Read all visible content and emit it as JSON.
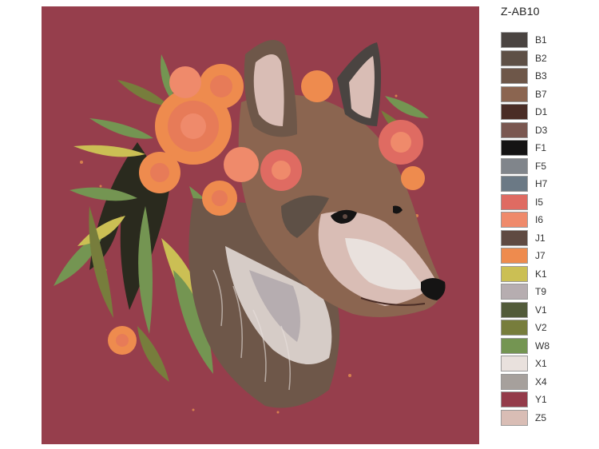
{
  "product_code": "Z-AB10",
  "artwork": {
    "background_color": "#963e4c"
  },
  "palette": [
    {
      "code": "B1",
      "color": "#4a4441"
    },
    {
      "code": "B2",
      "color": "#5e5046"
    },
    {
      "code": "B3",
      "color": "#6e5749"
    },
    {
      "code": "B7",
      "color": "#8b6550"
    },
    {
      "code": "D1",
      "color": "#4a2d26"
    },
    {
      "code": "D3",
      "color": "#7a5750"
    },
    {
      "code": "F1",
      "color": "#151414"
    },
    {
      "code": "F5",
      "color": "#80858b"
    },
    {
      "code": "H7",
      "color": "#6b7985"
    },
    {
      "code": "I5",
      "color": "#df6b62"
    },
    {
      "code": "I6",
      "color": "#ef8a6b"
    },
    {
      "code": "J1",
      "color": "#5f4a42"
    },
    {
      "code": "J7",
      "color": "#ee8b4e"
    },
    {
      "code": "K1",
      "color": "#cbbf54"
    },
    {
      "code": "T9",
      "color": "#b6adb0"
    },
    {
      "code": "V1",
      "color": "#525b3a"
    },
    {
      "code": "V2",
      "color": "#777d3c"
    },
    {
      "code": "W8",
      "color": "#749552"
    },
    {
      "code": "X1",
      "color": "#e9e1dd"
    },
    {
      "code": "X4",
      "color": "#a6a09c"
    },
    {
      "code": "Y1",
      "color": "#943b4a"
    },
    {
      "code": "Z5",
      "color": "#d9bdb5"
    }
  ]
}
